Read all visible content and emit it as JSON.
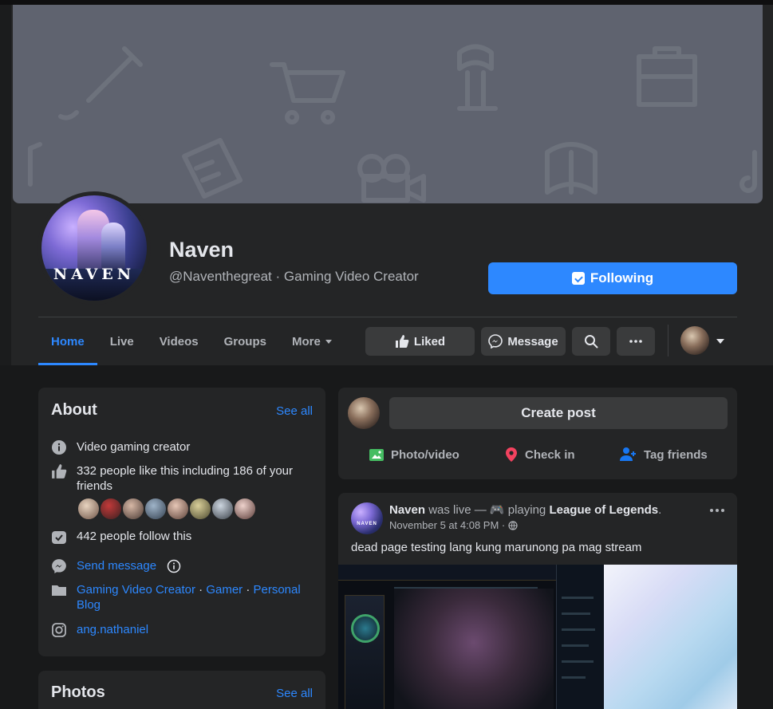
{
  "profile": {
    "name": "Naven",
    "handle_line": "@Naventhegreat · Gaming Video Creator",
    "avatar_logo": "NAVEN"
  },
  "header_actions": {
    "following_label": "Following",
    "liked_label": "Liked",
    "message_label": "Message",
    "search_icon": "search-icon",
    "more_icon": "ellipsis-icon"
  },
  "tabs": [
    {
      "label": "Home",
      "active": true
    },
    {
      "label": "Live",
      "active": false
    },
    {
      "label": "Videos",
      "active": false
    },
    {
      "label": "Groups",
      "active": false
    },
    {
      "label": "More",
      "active": false
    }
  ],
  "about": {
    "title": "About",
    "see_all": "See all",
    "category": "Video gaming creator",
    "likes": "332 people like this including 186 of your friends",
    "follows": "442 people follow this",
    "send_message": "Send message",
    "categories": [
      "Gaming Video Creator",
      "Gamer",
      "Personal Blog"
    ],
    "instagram": "ang.nathaniel"
  },
  "photos": {
    "title": "Photos",
    "see_all": "See all"
  },
  "create_post": {
    "box_label": "Create post",
    "photo_video": "Photo/video",
    "check_in": "Check in",
    "tag_friends": "Tag friends"
  },
  "post": {
    "author": "Naven",
    "activity_pre": "was live — 🎮 playing",
    "game": "League of Legends",
    "activity_post": ".",
    "timestamp": "November 5 at 4:08 PM ·",
    "text": "dead page testing lang kung marunong pa mag stream",
    "avatar_logo": "NAVEN"
  },
  "colors": {
    "accent": "#2d88ff",
    "surface": "#242526",
    "background": "#18191a",
    "cover": "#5f636f"
  }
}
